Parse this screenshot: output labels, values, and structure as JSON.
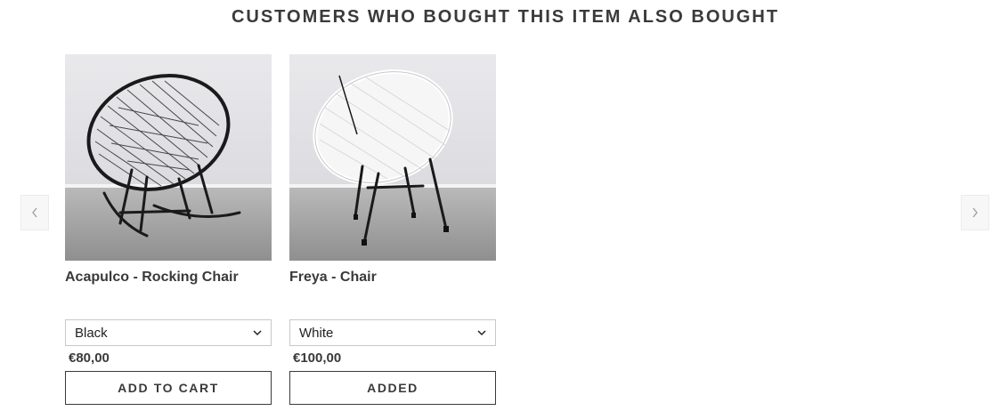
{
  "section": {
    "title": "CUSTOMERS WHO BOUGHT THIS ITEM ALSO BOUGHT"
  },
  "carousel": {
    "prev_icon": "chevron-left-icon",
    "next_icon": "chevron-right-icon"
  },
  "products": [
    {
      "title": "Acapulco - Rocking Chair",
      "image": "black-rocking-chair-image",
      "variant": "Black",
      "price": "€80,00",
      "button_label": "ADD TO CART"
    },
    {
      "title": "Freya - Chair",
      "image": "white-chair-image",
      "variant": "White",
      "price": "€100,00",
      "button_label": "ADDED"
    }
  ],
  "colors": {
    "text": "#3a3a3a",
    "border": "#c8c8c8",
    "arrow_bg": "#f7f7f7"
  }
}
